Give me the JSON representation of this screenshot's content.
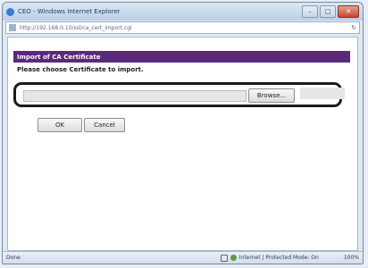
{
  "window": {
    "title": "CEO - Windows Internet Explorer"
  },
  "address": {
    "url": "http://192.168.0.10/ssl/ca_cert_import.cgi"
  },
  "page": {
    "header": "Import of CA Certificate",
    "instruction": "Please choose Certificate to import.",
    "browse_label": "Browse...",
    "ok_label": "OK",
    "cancel_label": "Cancel"
  },
  "status": {
    "left": "Done",
    "zone": "Internet | Protected Mode: On",
    "zoom": "100%"
  },
  "colors": {
    "header_bg": "#5a2a7a",
    "highlight_ring": "#1a1a1a"
  }
}
